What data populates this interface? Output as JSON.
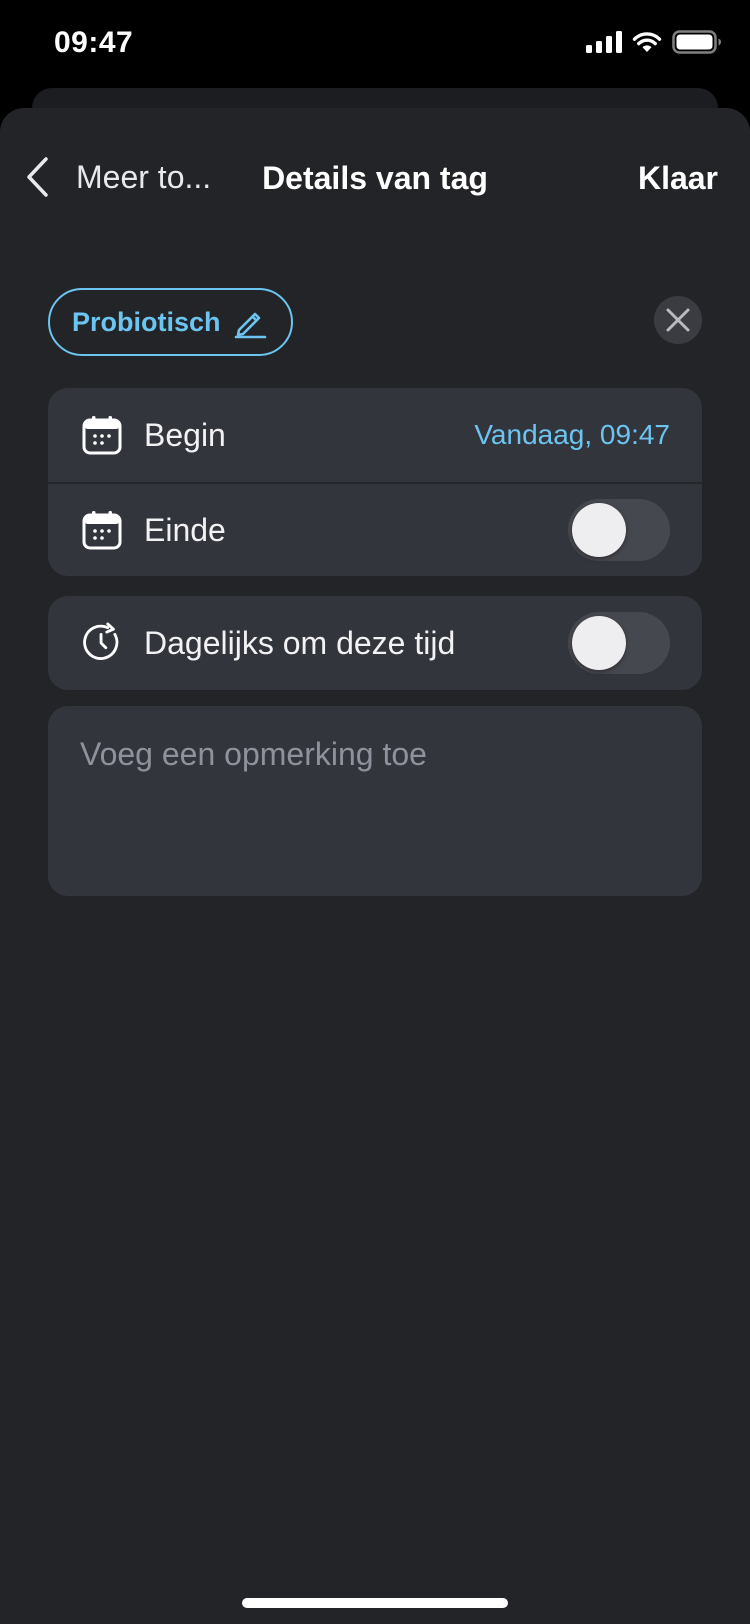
{
  "status": {
    "time": "09:47"
  },
  "nav": {
    "back_label": "Meer to...",
    "title": "Details van tag",
    "done_label": "Klaar"
  },
  "tag": {
    "label": "Probiotisch"
  },
  "time_group": {
    "begin_label": "Begin",
    "begin_value": "Vandaag, 09:47",
    "end_label": "Einde",
    "end_toggle_on": false
  },
  "repeat": {
    "label": "Dagelijks om deze tijd",
    "toggle_on": false
  },
  "note": {
    "placeholder": "Voeg een opmerking toe",
    "value": ""
  },
  "colors": {
    "accent": "#6cc4f0",
    "sheet": "#232428",
    "card": "#33353c"
  },
  "icons": [
    "signal-icon",
    "wifi-icon",
    "battery-icon",
    "chevron-left-icon",
    "pencil-icon",
    "close-icon",
    "calendar-icon",
    "repeat-clock-icon"
  ]
}
